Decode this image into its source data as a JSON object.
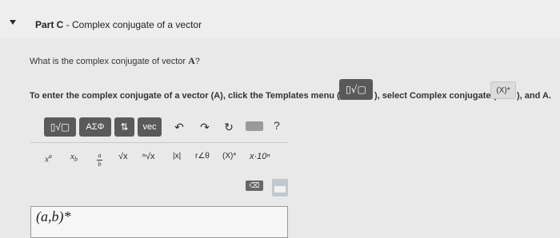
{
  "part": {
    "label": "Part C",
    "separator": " - ",
    "title": "Complex conjugate of a vector"
  },
  "question": {
    "text": "What is the complex conjugate of vector ",
    "vector": "A",
    "suffix": "?"
  },
  "instructions": {
    "part1": "To enter the complex conjugate of a vector (A), click the Templates menu (",
    "part2": "), select Complex conjugate (",
    "part3": "), and A.",
    "templates_icon": "▯√▢",
    "conj_icon": "(X)*"
  },
  "toolbar": {
    "templates": "▯√▢",
    "greek": "ΑΣΦ",
    "arrows": "⇅",
    "vec": "vec",
    "undo": "↶",
    "redo": "↷",
    "reset": "↻",
    "help": "?"
  },
  "templates_row": {
    "superscript": "x",
    "superscript_exp": "a",
    "subscript": "x",
    "subscript_idx": "b",
    "fraction_num": "a",
    "fraction_den": "b",
    "sqrt": "√x",
    "nthroot": "ⁿ√x",
    "abs": "|x|",
    "polar": "r∠θ",
    "conj": "(X)*",
    "scientific": "x·10ⁿ"
  },
  "actions": {
    "delete": "⌫"
  },
  "answer": {
    "value": "(a,b)*"
  }
}
